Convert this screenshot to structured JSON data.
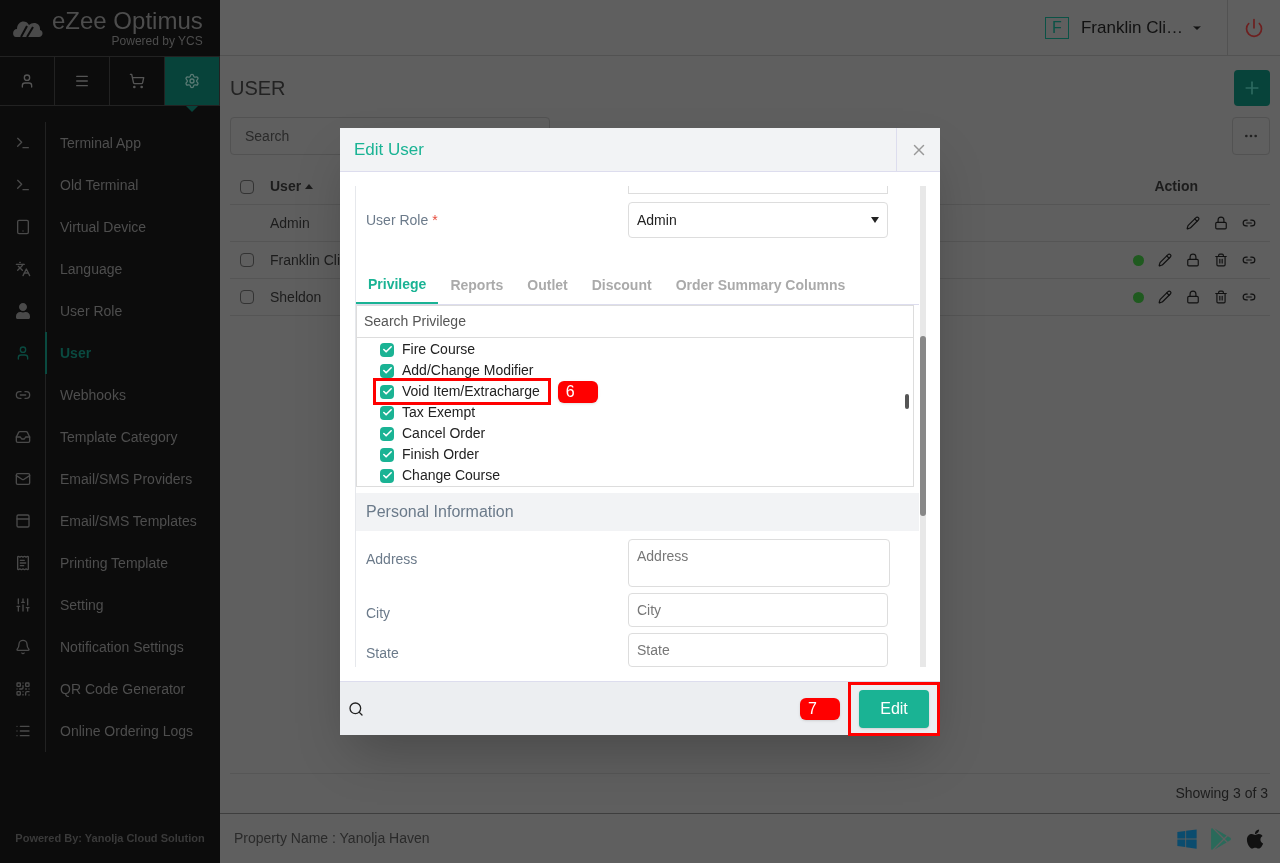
{
  "brand": {
    "name": "eZee Optimus",
    "tagline": "Powered by YCS"
  },
  "top_tabs": [
    {
      "selected": false
    },
    {
      "selected": false
    },
    {
      "selected": false
    },
    {
      "selected": true
    }
  ],
  "sidebar": {
    "items": [
      {
        "label": "Terminal App",
        "selected": false
      },
      {
        "label": "Old Terminal",
        "selected": false
      },
      {
        "label": "Virtual Device",
        "selected": false
      },
      {
        "label": "Language",
        "selected": false
      },
      {
        "label": "User Role",
        "selected": false
      },
      {
        "label": "User",
        "selected": true
      },
      {
        "label": "Webhooks",
        "selected": false
      },
      {
        "label": "Template Category",
        "selected": false
      },
      {
        "label": "Email/SMS Providers",
        "selected": false
      },
      {
        "label": "Email/SMS Templates",
        "selected": false
      },
      {
        "label": "Printing Template",
        "selected": false
      },
      {
        "label": "Setting",
        "selected": false
      },
      {
        "label": "Notification Settings",
        "selected": false
      },
      {
        "label": "QR Code Generator",
        "selected": false
      },
      {
        "label": "Online Ordering Logs",
        "selected": false
      }
    ],
    "footer": "Powered By: Yanolja Cloud Solution"
  },
  "header": {
    "avatar_letter": "F",
    "user_name": "Franklin Cli…"
  },
  "page": {
    "title": "USER",
    "search": {
      "placeholder": "Search"
    },
    "table": {
      "select_all": {
        "checked": false
      },
      "columns": [
        "User",
        "Action"
      ],
      "rows": [
        {
          "user": "Admin",
          "has_checkbox": false,
          "active": false,
          "deletable": false
        },
        {
          "user": "Franklin Cli",
          "has_checkbox": true,
          "checked": false,
          "active": true,
          "deletable": true
        },
        {
          "user": "Sheldon",
          "has_checkbox": true,
          "checked": false,
          "active": true,
          "deletable": true
        }
      ]
    },
    "showing": "Showing 3 of 3"
  },
  "footer": {
    "property": "Property Name : Yanolja Haven"
  },
  "modal": {
    "title": "Edit User",
    "role": {
      "label": "User Role",
      "required_mark": "*",
      "value": "Admin"
    },
    "tabs": [
      {
        "label": "Privilege",
        "selected": true
      },
      {
        "label": "Reports",
        "selected": false
      },
      {
        "label": "Outlet",
        "selected": false
      },
      {
        "label": "Discount",
        "selected": false
      },
      {
        "label": "Order Summary Columns",
        "selected": false
      }
    ],
    "privilege_search": {
      "placeholder": "Search Privilege"
    },
    "privileges": [
      {
        "label": "Fire Course",
        "checked": true,
        "highlighted": false
      },
      {
        "label": "Add/Change Modifier",
        "checked": true,
        "highlighted": false
      },
      {
        "label": "Void Item/Extracharge",
        "checked": true,
        "highlighted": true,
        "badge": "6"
      },
      {
        "label": "Tax Exempt",
        "checked": true,
        "highlighted": false
      },
      {
        "label": "Cancel Order",
        "checked": true,
        "highlighted": false
      },
      {
        "label": "Finish Order",
        "checked": true,
        "highlighted": false
      },
      {
        "label": "Change Course",
        "checked": true,
        "highlighted": false
      }
    ],
    "section": "Personal Information",
    "personal_fields": [
      {
        "label": "Address",
        "placeholder": "Address",
        "kind": "textarea"
      },
      {
        "label": "City",
        "placeholder": "City",
        "kind": "input"
      },
      {
        "label": "State",
        "placeholder": "State",
        "kind": "input"
      }
    ],
    "submit": {
      "label": "Edit",
      "badge": "7",
      "highlighted": true
    }
  }
}
